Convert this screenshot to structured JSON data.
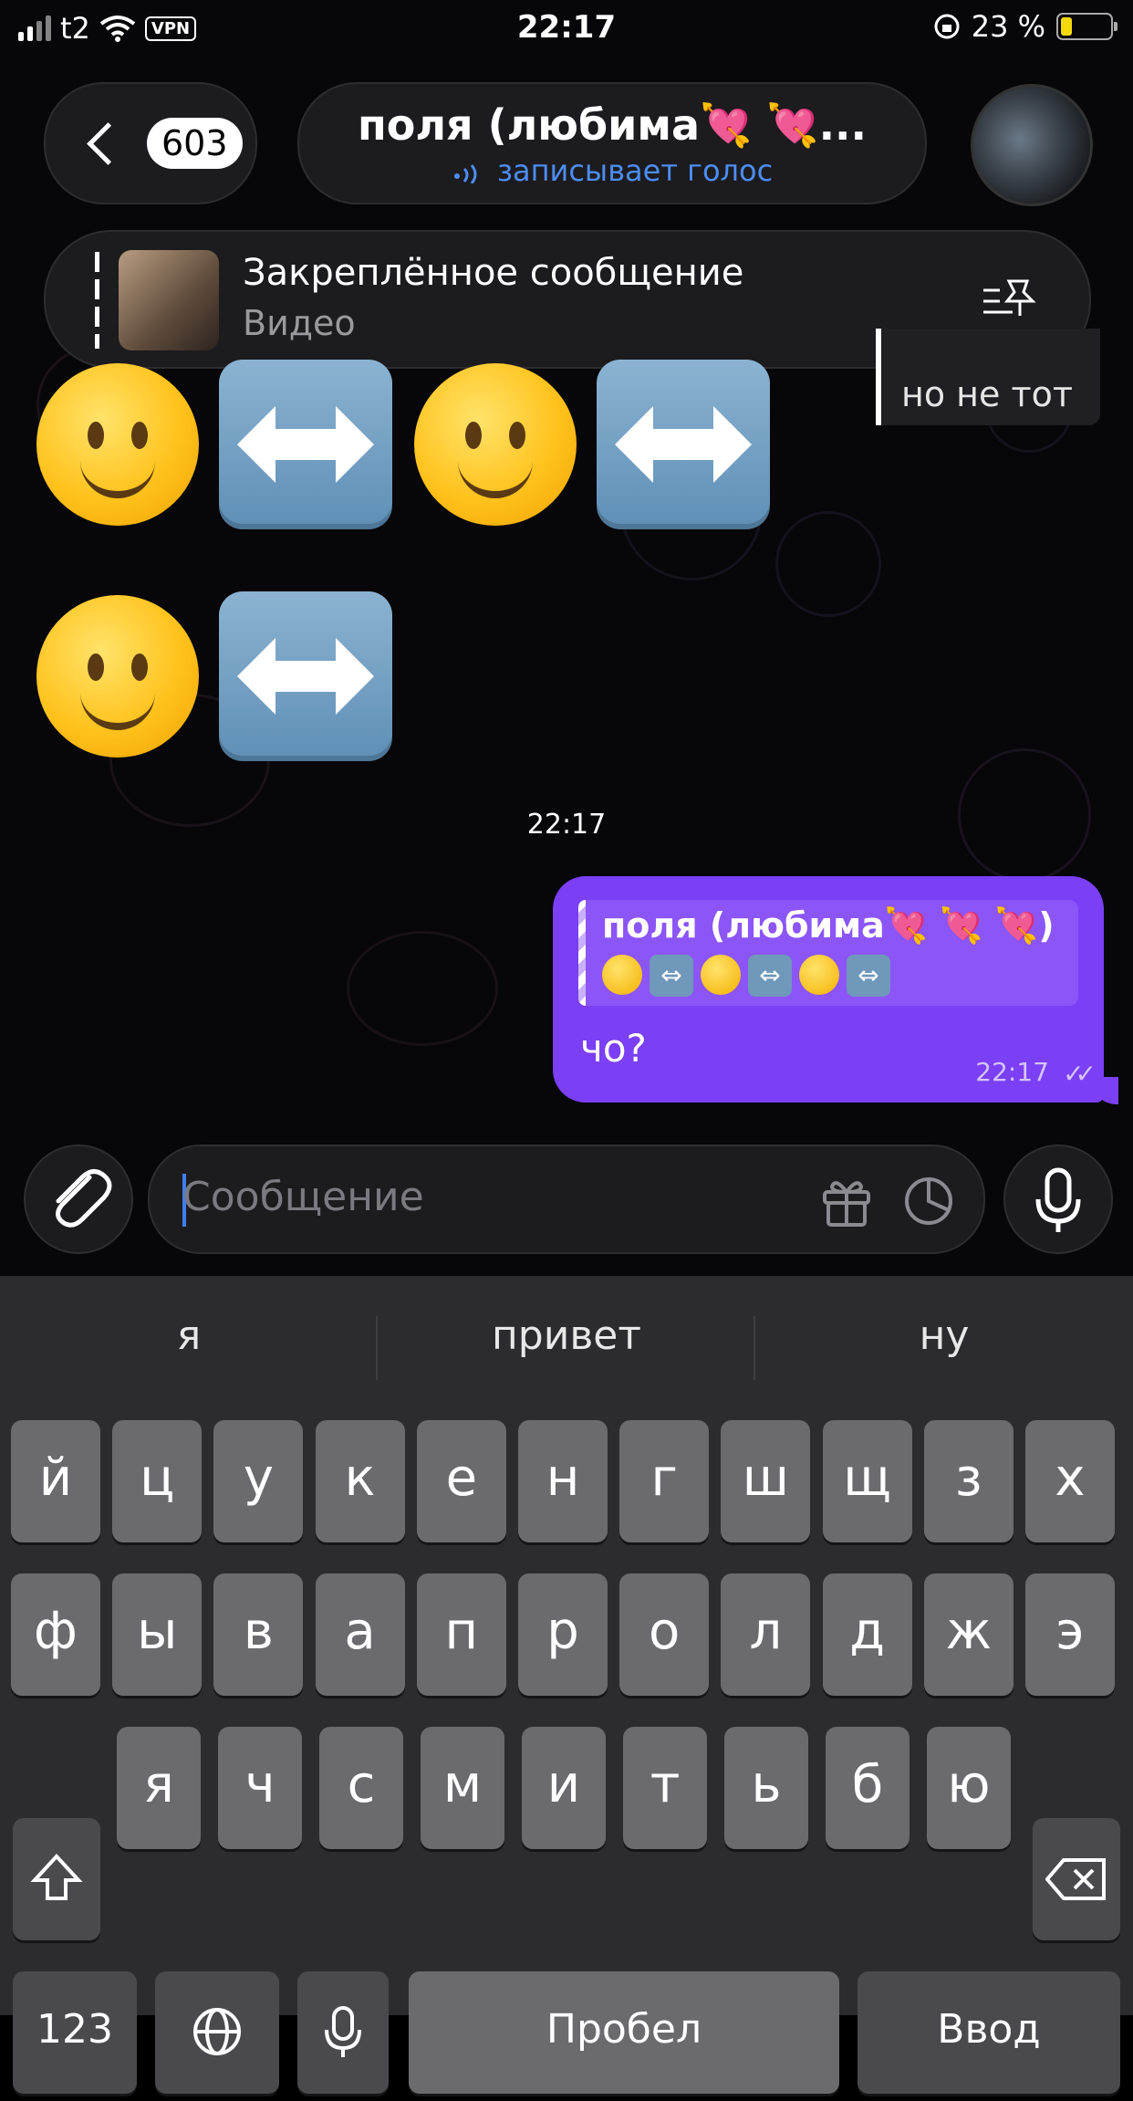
{
  "status_bar": {
    "carrier": "t2",
    "vpn": "VPN",
    "time": "22:17",
    "battery": "23 %",
    "battery_level": 0.23
  },
  "header": {
    "back_count": "603",
    "chat_title": "поля (любима💘 💘...",
    "chat_status": "записывает голос"
  },
  "pinned": {
    "title": "Закреплённое сообщение",
    "subtitle": "Видео"
  },
  "side_message": {
    "text": "но не тот"
  },
  "messages": {
    "time_divider": "22:17",
    "outgoing": {
      "reply_name": "поля (любима💘 💘 💘)",
      "reply_emoji_glyphs": [
        "⇔",
        "⇔",
        "⇔"
      ],
      "text": "чо?",
      "time": "22:17",
      "status": "✓✓"
    }
  },
  "input": {
    "placeholder": "Сообщение"
  },
  "keyboard": {
    "suggestions": [
      "я",
      "привет",
      "ну"
    ],
    "row1": [
      "й",
      "ц",
      "у",
      "к",
      "е",
      "н",
      "г",
      "ш",
      "щ",
      "з",
      "х"
    ],
    "row2": [
      "ф",
      "ы",
      "в",
      "а",
      "п",
      "р",
      "о",
      "л",
      "д",
      "ж",
      "э"
    ],
    "row3": [
      "я",
      "ч",
      "с",
      "м",
      "и",
      "т",
      "ь",
      "б",
      "ю"
    ],
    "numbers": "123",
    "space": "Пробел",
    "enter": "Ввод"
  }
}
